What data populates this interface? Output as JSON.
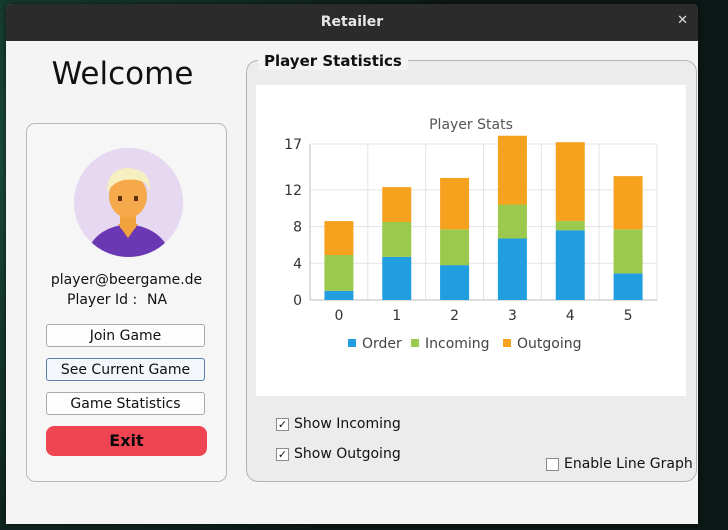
{
  "window": {
    "title": "Retailer"
  },
  "welcome": "Welcome",
  "user": {
    "email": "player@beergame.de",
    "player_id_label": "Player Id :",
    "player_id_value": "NA"
  },
  "buttons": {
    "join": "Join Game",
    "see_current": "See Current Game",
    "stats": "Game Statistics",
    "exit": "Exit"
  },
  "panel": {
    "title": "Player Statistics"
  },
  "checkboxes": {
    "incoming": {
      "label": "Show Incoming",
      "checked": true
    },
    "outgoing": {
      "label": "Show Outgoing",
      "checked": true
    },
    "line_graph": {
      "label": "Enable Line Graph",
      "checked": false
    }
  },
  "colors": {
    "order": "#209ee0",
    "incoming": "#9bc94e",
    "outgoing": "#f6a21f",
    "exit": "#ef4452"
  },
  "chart_data": {
    "type": "bar",
    "stacked": true,
    "title": "Player Stats",
    "categories": [
      "0",
      "1",
      "2",
      "3",
      "4",
      "5"
    ],
    "series": [
      {
        "name": "Order",
        "values": [
          1,
          4.7,
          3.8,
          6.7,
          7.6,
          2.9
        ]
      },
      {
        "name": "Incoming",
        "values": [
          3.9,
          3.8,
          3.9,
          3.7,
          1,
          4.8
        ]
      },
      {
        "name": "Outgoing",
        "values": [
          3.7,
          3.8,
          5.6,
          7.5,
          8.6,
          5.8
        ]
      }
    ],
    "yticks": [
      "0",
      "4",
      "8",
      "12",
      "17"
    ],
    "ylim": [
      0,
      17
    ],
    "grid": true,
    "legend": "bottom"
  }
}
